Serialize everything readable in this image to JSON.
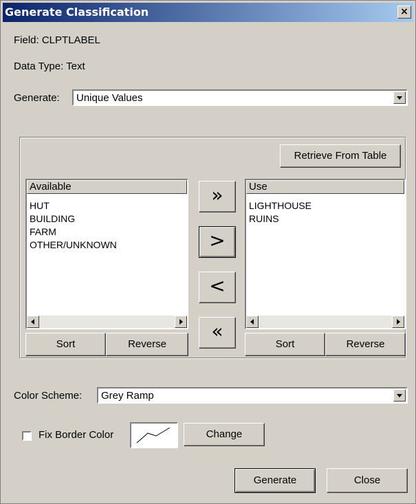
{
  "window": {
    "title": "Generate Classification",
    "close_glyph": "×"
  },
  "info": {
    "field": "Field: CLPTLABEL",
    "data_type": "Data Type: Text"
  },
  "generate_row": {
    "label": "Generate:",
    "value": "Unique Values"
  },
  "retrieve_button": "Retrieve From Table",
  "available": {
    "header": "Available",
    "items": [
      "HUT",
      "BUILDING",
      "FARM",
      "OTHER/UNKNOWN"
    ],
    "sort_label": "Sort",
    "reverse_label": "Reverse"
  },
  "use": {
    "header": "Use",
    "items": [
      "LIGHTHOUSE",
      "RUINS"
    ],
    "sort_label": "Sort",
    "reverse_label": "Reverse"
  },
  "transfer": {
    "add_all": "»",
    "add_one": ">",
    "remove_one": "<",
    "remove_all": "«"
  },
  "color_scheme": {
    "label": "Color Scheme:",
    "value": "Grey Ramp"
  },
  "border": {
    "label": "Fix Border Color",
    "checked": false,
    "change_label": "Change"
  },
  "footer": {
    "generate_label": "Generate",
    "close_label": "Close"
  },
  "colors": {
    "title_start": "#0a246a",
    "title_end": "#a6caf0",
    "face": "#d4d0c8"
  }
}
